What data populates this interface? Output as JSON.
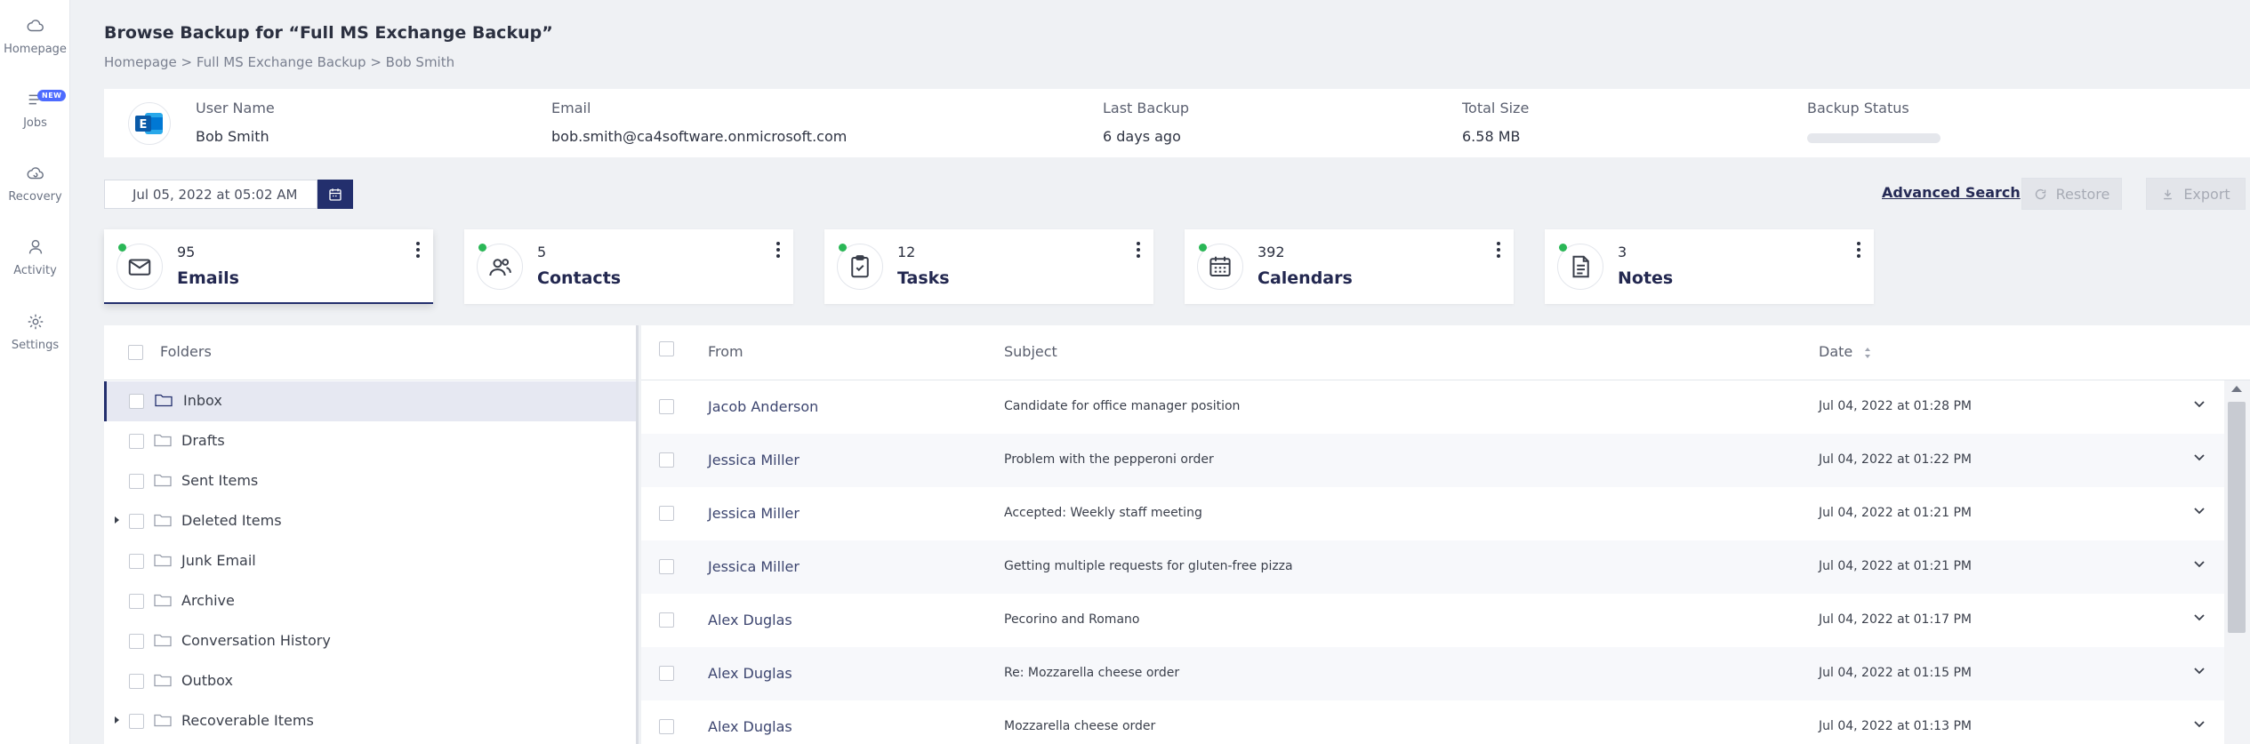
{
  "sidebar": {
    "items": [
      {
        "label": "Homepage",
        "icon": "cloud-icon"
      },
      {
        "label": "Jobs",
        "icon": "list-icon",
        "badge": "NEW"
      },
      {
        "label": "Recovery",
        "icon": "cloud-recovery-icon"
      },
      {
        "label": "Activity",
        "icon": "user-icon"
      },
      {
        "label": "Settings",
        "icon": "gear-icon"
      }
    ]
  },
  "header": {
    "title": "Browse Backup for “Full MS Exchange Backup”",
    "breadcrumb": "Homepage > Full MS Exchange Backup > Bob Smith"
  },
  "user_info": {
    "user_name_label": "User Name",
    "user_name": "Bob Smith",
    "email_label": "Email",
    "email": "bob.smith@ca4software.onmicrosoft.com",
    "last_backup_label": "Last Backup",
    "last_backup": "6 days ago",
    "total_size_label": "Total Size",
    "total_size": "6.58 MB",
    "backup_status_label": "Backup Status"
  },
  "toolbar": {
    "date_value": "Jul 05, 2022 at 05:02 AM",
    "advanced_search": "Advanced Search",
    "restore": "Restore",
    "export": "Export"
  },
  "categories": [
    {
      "count": "95",
      "name": "Emails",
      "icon": "mail-icon"
    },
    {
      "count": "5",
      "name": "Contacts",
      "icon": "contacts-icon"
    },
    {
      "count": "12",
      "name": "Tasks",
      "icon": "tasks-icon"
    },
    {
      "count": "392",
      "name": "Calendars",
      "icon": "calendar-icon"
    },
    {
      "count": "3",
      "name": "Notes",
      "icon": "notes-icon"
    }
  ],
  "folders": {
    "header": "Folders",
    "items": [
      {
        "label": "Inbox",
        "selected": true,
        "expandable": false
      },
      {
        "label": "Drafts",
        "expandable": false
      },
      {
        "label": "Sent Items",
        "expandable": false
      },
      {
        "label": "Deleted Items",
        "expandable": true
      },
      {
        "label": "Junk Email",
        "expandable": false
      },
      {
        "label": "Archive",
        "expandable": false
      },
      {
        "label": "Conversation History",
        "expandable": false
      },
      {
        "label": "Outbox",
        "expandable": false
      },
      {
        "label": "Recoverable Items",
        "expandable": true
      }
    ]
  },
  "mail": {
    "columns": {
      "from": "From",
      "subject": "Subject",
      "date": "Date"
    },
    "rows": [
      {
        "from": "Jacob Anderson",
        "subject": "Candidate for office manager position",
        "date": "Jul 04, 2022 at 01:28 PM"
      },
      {
        "from": "Jessica Miller",
        "subject": "Problem with the pepperoni order",
        "date": "Jul 04, 2022 at 01:22 PM"
      },
      {
        "from": "Jessica Miller",
        "subject": "Accepted: Weekly staff meeting",
        "date": "Jul 04, 2022 at 01:21 PM"
      },
      {
        "from": "Jessica Miller",
        "subject": "Getting multiple requests for gluten-free pizza",
        "date": "Jul 04, 2022 at 01:21 PM"
      },
      {
        "from": "Alex Duglas",
        "subject": "Pecorino and Romano",
        "date": "Jul 04, 2022 at 01:17 PM"
      },
      {
        "from": "Alex Duglas",
        "subject": "Re: Mozzarella cheese order",
        "date": "Jul 04, 2022 at 01:15 PM"
      },
      {
        "from": "Alex Duglas",
        "subject": "Mozzarella cheese order",
        "date": "Jul 04, 2022 at 01:13 PM"
      }
    ]
  },
  "colors": {
    "accent": "#232f6d",
    "status_green": "#2ab756",
    "badge_blue": "#4d6bff"
  }
}
